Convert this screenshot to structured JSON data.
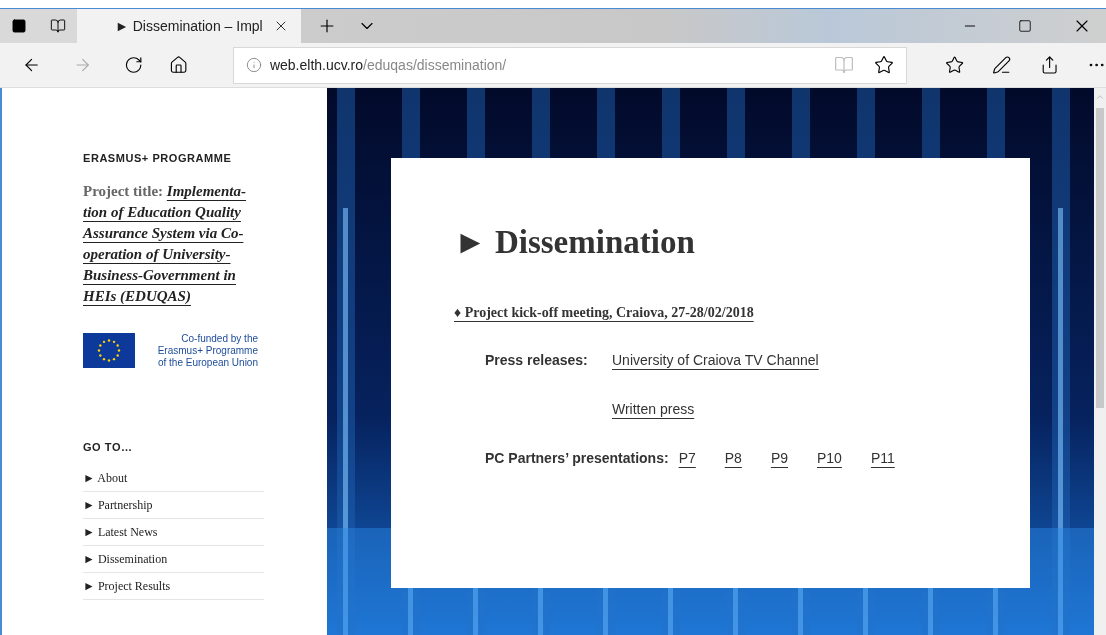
{
  "browser": {
    "tab": {
      "title": "► Dissemination – Impl",
      "selected": true
    },
    "url_host": "web.elth.ucv.ro",
    "url_path": "/eduqas/dissemination/"
  },
  "sidebar": {
    "heading": "ERASMUS+ PROGRAMME",
    "title_label": "Project title:",
    "title_lines": [
      "Implementa-",
      "tion of Education Quality",
      "Assurance System via Co-",
      "operation of University-",
      "Business-Government in",
      "HEIs (EDUQAS)"
    ],
    "eu_note": [
      "Co-funded by the",
      "Erasmus+ Programme",
      "of the European Union"
    ],
    "goto_heading": "GO TO…",
    "nav": [
      "► About",
      "► Partnership",
      "► Latest News",
      "► Dissemination",
      "► Project Results"
    ]
  },
  "main": {
    "heading": "► Dissemination",
    "event": "♦ Project kick-off meeting, Craiova, 27-28/02/2018",
    "press_label": "Press releases:",
    "press_links": [
      "University of Craiova TV Channel",
      "Written press"
    ],
    "partners_label": "PC Partners’ presentations:",
    "partner_links": [
      "P7",
      "P8",
      "P9",
      "P10",
      "P11"
    ]
  }
}
